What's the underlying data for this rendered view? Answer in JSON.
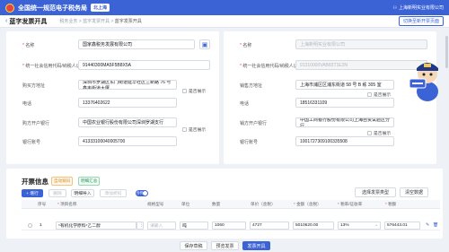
{
  "topbar": {
    "brand": "全国统一规范电子税务局",
    "region": "北上海",
    "user": "上海新明实业有限公司"
  },
  "subbar": {
    "title": "蓝字发票开具",
    "crumbs": [
      "税务业务",
      "蓝字发票开具"
    ],
    "current": "蓝字发票开具",
    "switch_label": "切换至新开票页面"
  },
  "buyer": {
    "name_label": "名称",
    "name_value": "国家鑫税务发展有限公司",
    "taxid_label": "统一社会信用代码/纳税人识别号",
    "taxid_value": "91440300MA5F5B8X5A",
    "addr_label": "购买方地址",
    "addr_value": "深圳市罗湖区东门街道延华社区兰新路 76 号鑫丰街道大厦",
    "phone_label": "电话",
    "phone_value": "13376402622",
    "bank_label": "购方开户银行",
    "bank_value": "中国农业银行股份有限公司深圳罗湖支行",
    "acct_label": "银行账号",
    "acct_value": "41333100040005700",
    "show_label": "是否展示"
  },
  "seller": {
    "name_label": "名称",
    "name_value": "上海新明实业有限公司",
    "taxid_label": "统一社会信用代码/纳税人识别号",
    "taxid_value": "91310000VAB83T1E2N",
    "addr_label": "销售方地址",
    "addr_value": "上海市浦区区浦东街道 58 号 B 栋 305 室",
    "phone_label": "电话",
    "phone_value": "18516331109",
    "bank_label": "销方开户银行",
    "bank_value": "中国工商银行股份有限公司上海自贸试验区分行",
    "acct_label": "银行账号",
    "acct_value": "1001727309100335508",
    "show_label": "是否展示"
  },
  "invoice": {
    "title": "开票信息",
    "tags": [
      "自动赋码",
      "明细汇总"
    ],
    "buttons": {
      "add": "+ 增行",
      "delete": "删除",
      "import": "明细导入",
      "discount": "添加折扣",
      "toggle": "含税"
    },
    "right_buttons": {
      "pick": "选择发票类型",
      "clear": "清空数据"
    },
    "columns": [
      "序号",
      "项目名称",
      "规格型号",
      "单位",
      "数量",
      "单价（含税）",
      "金额（含税）",
      "税率/征收率",
      "税额"
    ],
    "rows": [
      {
        "no": "1",
        "item": "*有机化学原料*乙二醇",
        "spec": "请输入",
        "unit": "吨",
        "qty": "1060",
        "price": "4727",
        "amount": "5010620.00",
        "rate": "13%",
        "tax": "576443.01"
      }
    ]
  },
  "footer": {
    "save": "保存草稿",
    "preview": "预览发票",
    "issue": "发票开具"
  },
  "colors": {
    "primary": "#3b63d6",
    "required": "#e24b4b"
  }
}
